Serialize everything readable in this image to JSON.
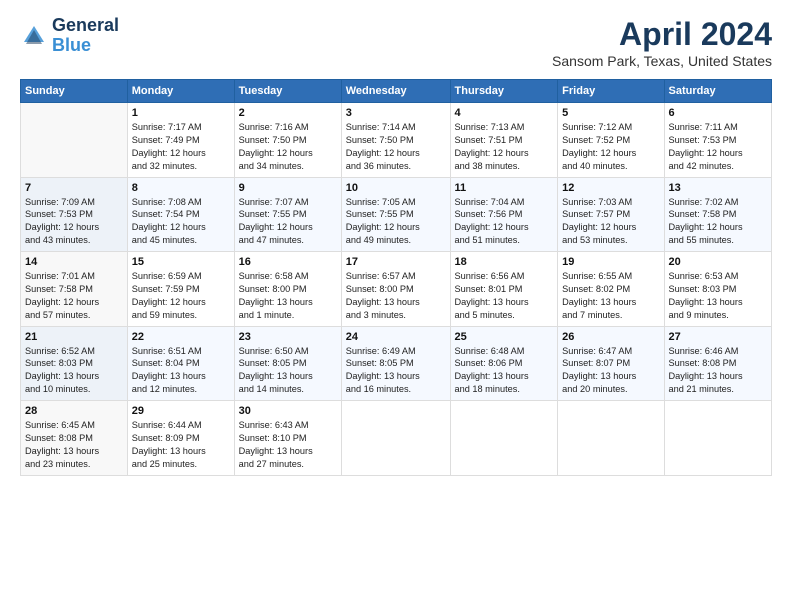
{
  "header": {
    "logo_line1": "General",
    "logo_line2": "Blue",
    "month": "April 2024",
    "location": "Sansom Park, Texas, United States"
  },
  "columns": [
    "Sunday",
    "Monday",
    "Tuesday",
    "Wednesday",
    "Thursday",
    "Friday",
    "Saturday"
  ],
  "weeks": [
    [
      {
        "day": "",
        "info": ""
      },
      {
        "day": "1",
        "info": "Sunrise: 7:17 AM\nSunset: 7:49 PM\nDaylight: 12 hours\nand 32 minutes."
      },
      {
        "day": "2",
        "info": "Sunrise: 7:16 AM\nSunset: 7:50 PM\nDaylight: 12 hours\nand 34 minutes."
      },
      {
        "day": "3",
        "info": "Sunrise: 7:14 AM\nSunset: 7:50 PM\nDaylight: 12 hours\nand 36 minutes."
      },
      {
        "day": "4",
        "info": "Sunrise: 7:13 AM\nSunset: 7:51 PM\nDaylight: 12 hours\nand 38 minutes."
      },
      {
        "day": "5",
        "info": "Sunrise: 7:12 AM\nSunset: 7:52 PM\nDaylight: 12 hours\nand 40 minutes."
      },
      {
        "day": "6",
        "info": "Sunrise: 7:11 AM\nSunset: 7:53 PM\nDaylight: 12 hours\nand 42 minutes."
      }
    ],
    [
      {
        "day": "7",
        "info": "Sunrise: 7:09 AM\nSunset: 7:53 PM\nDaylight: 12 hours\nand 43 minutes."
      },
      {
        "day": "8",
        "info": "Sunrise: 7:08 AM\nSunset: 7:54 PM\nDaylight: 12 hours\nand 45 minutes."
      },
      {
        "day": "9",
        "info": "Sunrise: 7:07 AM\nSunset: 7:55 PM\nDaylight: 12 hours\nand 47 minutes."
      },
      {
        "day": "10",
        "info": "Sunrise: 7:05 AM\nSunset: 7:55 PM\nDaylight: 12 hours\nand 49 minutes."
      },
      {
        "day": "11",
        "info": "Sunrise: 7:04 AM\nSunset: 7:56 PM\nDaylight: 12 hours\nand 51 minutes."
      },
      {
        "day": "12",
        "info": "Sunrise: 7:03 AM\nSunset: 7:57 PM\nDaylight: 12 hours\nand 53 minutes."
      },
      {
        "day": "13",
        "info": "Sunrise: 7:02 AM\nSunset: 7:58 PM\nDaylight: 12 hours\nand 55 minutes."
      }
    ],
    [
      {
        "day": "14",
        "info": "Sunrise: 7:01 AM\nSunset: 7:58 PM\nDaylight: 12 hours\nand 57 minutes."
      },
      {
        "day": "15",
        "info": "Sunrise: 6:59 AM\nSunset: 7:59 PM\nDaylight: 12 hours\nand 59 minutes."
      },
      {
        "day": "16",
        "info": "Sunrise: 6:58 AM\nSunset: 8:00 PM\nDaylight: 13 hours\nand 1 minute."
      },
      {
        "day": "17",
        "info": "Sunrise: 6:57 AM\nSunset: 8:00 PM\nDaylight: 13 hours\nand 3 minutes."
      },
      {
        "day": "18",
        "info": "Sunrise: 6:56 AM\nSunset: 8:01 PM\nDaylight: 13 hours\nand 5 minutes."
      },
      {
        "day": "19",
        "info": "Sunrise: 6:55 AM\nSunset: 8:02 PM\nDaylight: 13 hours\nand 7 minutes."
      },
      {
        "day": "20",
        "info": "Sunrise: 6:53 AM\nSunset: 8:03 PM\nDaylight: 13 hours\nand 9 minutes."
      }
    ],
    [
      {
        "day": "21",
        "info": "Sunrise: 6:52 AM\nSunset: 8:03 PM\nDaylight: 13 hours\nand 10 minutes."
      },
      {
        "day": "22",
        "info": "Sunrise: 6:51 AM\nSunset: 8:04 PM\nDaylight: 13 hours\nand 12 minutes."
      },
      {
        "day": "23",
        "info": "Sunrise: 6:50 AM\nSunset: 8:05 PM\nDaylight: 13 hours\nand 14 minutes."
      },
      {
        "day": "24",
        "info": "Sunrise: 6:49 AM\nSunset: 8:05 PM\nDaylight: 13 hours\nand 16 minutes."
      },
      {
        "day": "25",
        "info": "Sunrise: 6:48 AM\nSunset: 8:06 PM\nDaylight: 13 hours\nand 18 minutes."
      },
      {
        "day": "26",
        "info": "Sunrise: 6:47 AM\nSunset: 8:07 PM\nDaylight: 13 hours\nand 20 minutes."
      },
      {
        "day": "27",
        "info": "Sunrise: 6:46 AM\nSunset: 8:08 PM\nDaylight: 13 hours\nand 21 minutes."
      }
    ],
    [
      {
        "day": "28",
        "info": "Sunrise: 6:45 AM\nSunset: 8:08 PM\nDaylight: 13 hours\nand 23 minutes."
      },
      {
        "day": "29",
        "info": "Sunrise: 6:44 AM\nSunset: 8:09 PM\nDaylight: 13 hours\nand 25 minutes."
      },
      {
        "day": "30",
        "info": "Sunrise: 6:43 AM\nSunset: 8:10 PM\nDaylight: 13 hours\nand 27 minutes."
      },
      {
        "day": "",
        "info": ""
      },
      {
        "day": "",
        "info": ""
      },
      {
        "day": "",
        "info": ""
      },
      {
        "day": "",
        "info": ""
      }
    ]
  ]
}
